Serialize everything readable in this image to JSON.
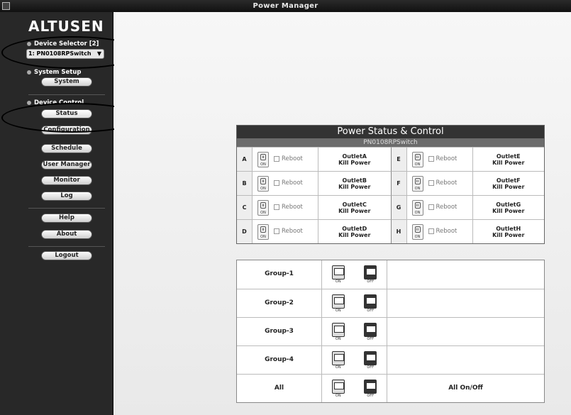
{
  "window": {
    "title": "Power Manager"
  },
  "sidebar": {
    "logo": "ALTUSEN",
    "device_selector_label": "Device Selector [2]",
    "device_selected": "1: PN0108RPSwitch",
    "system_setup_label": "System Setup",
    "device_control_label": "Device Control",
    "buttons": {
      "system": "System",
      "status": "Status",
      "configuration": "Configuration",
      "schedule": "Schedule",
      "user_manager": "User Manager",
      "monitor": "Monitor",
      "log": "Log",
      "help": "Help",
      "about": "About",
      "logout": "Logout"
    }
  },
  "panel": {
    "title": "Power Status & Control",
    "subtitle": "PN0108RPSwitch",
    "reboot_label": "Reboot",
    "kill_label": "Kill Power",
    "on_label": "ON",
    "outlets_left": [
      {
        "letter": "A",
        "name": "OutletA"
      },
      {
        "letter": "B",
        "name": "OutletB"
      },
      {
        "letter": "C",
        "name": "OutletC"
      },
      {
        "letter": "D",
        "name": "OutletD"
      }
    ],
    "outlets_right": [
      {
        "letter": "E",
        "name": "OutletE"
      },
      {
        "letter": "F",
        "name": "OutletF"
      },
      {
        "letter": "G",
        "name": "OutletG"
      },
      {
        "letter": "H",
        "name": "OutletH"
      }
    ]
  },
  "groups": {
    "on_label": "ON",
    "off_label": "OFF",
    "rows": [
      {
        "name": "Group-1",
        "extra": ""
      },
      {
        "name": "Group-2",
        "extra": ""
      },
      {
        "name": "Group-3",
        "extra": ""
      },
      {
        "name": "Group-4",
        "extra": ""
      },
      {
        "name": "All",
        "extra": "All On/Off"
      }
    ]
  }
}
